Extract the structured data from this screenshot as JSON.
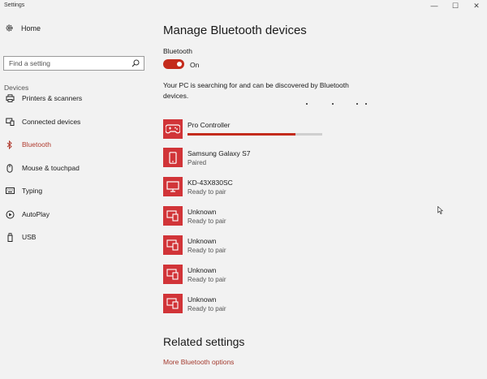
{
  "window": {
    "title": "Settings",
    "controls": [
      "—",
      "☐",
      "✕"
    ]
  },
  "nav": {
    "home_label": "Home",
    "search_placeholder": "Find a setting",
    "section_label": "Devices",
    "items": [
      {
        "label": "Printers & scanners",
        "icon": "printer-icon"
      },
      {
        "label": "Connected devices",
        "icon": "connected-devices-icon"
      },
      {
        "label": "Bluetooth",
        "icon": "bluetooth-icon",
        "active": true
      },
      {
        "label": "Mouse & touchpad",
        "icon": "mouse-icon"
      },
      {
        "label": "Typing",
        "icon": "keyboard-icon"
      },
      {
        "label": "AutoPlay",
        "icon": "autoplay-icon"
      },
      {
        "label": "USB",
        "icon": "usb-icon"
      }
    ]
  },
  "main": {
    "title": "Manage Bluetooth devices",
    "bluetooth_label": "Bluetooth",
    "toggle_state": "On",
    "status_text": "Your PC is searching for and can be discovered by Bluetooth devices.",
    "devices": [
      {
        "name": "Pro Controller",
        "status": "",
        "icon": "gamepad-icon",
        "progress": 0.8
      },
      {
        "name": "Samsung Galaxy S7",
        "status": "Paired",
        "icon": "phone-icon"
      },
      {
        "name": "KD-43X830SC",
        "status": "Ready to pair",
        "icon": "monitor-icon"
      },
      {
        "name": "Unknown",
        "status": "Ready to pair",
        "icon": "multi-device-icon"
      },
      {
        "name": "Unknown",
        "status": "Ready to pair",
        "icon": "multi-device-icon"
      },
      {
        "name": "Unknown",
        "status": "Ready to pair",
        "icon": "multi-device-icon"
      },
      {
        "name": "Unknown",
        "status": "Ready to pair",
        "icon": "multi-device-icon"
      }
    ],
    "related_title": "Related settings",
    "related_link": "More Bluetooth options"
  },
  "colors": {
    "accent": "#c42b1c",
    "tile": "#d13438",
    "link": "#a33a2e",
    "background": "#f2f2f2"
  }
}
